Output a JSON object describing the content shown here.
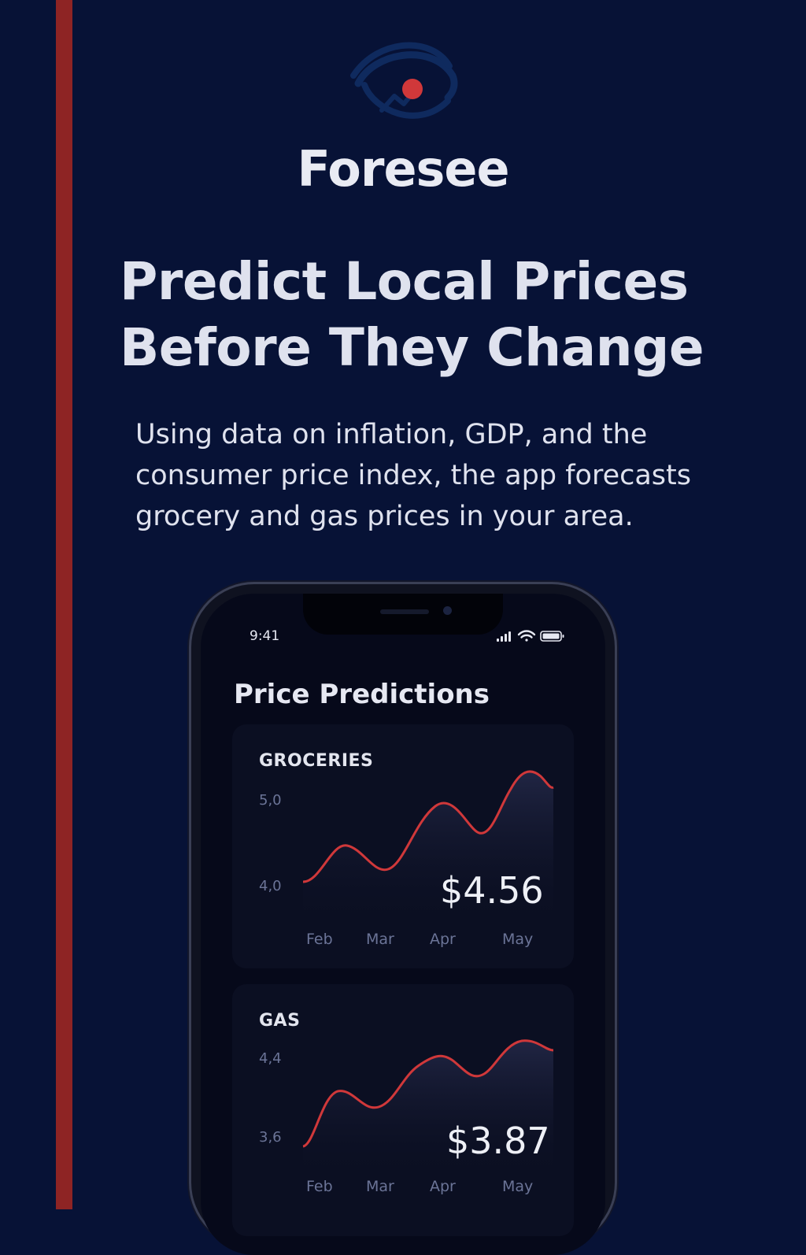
{
  "brand": {
    "name": "Foresee",
    "logo_icon": "eye-chart-icon",
    "accent_color": "#d0383a"
  },
  "headline": [
    "Predict Local Prices",
    "Before They Change"
  ],
  "subtext": [
    "Using data on inflation, GDP, and the",
    "consumer price index, the app forecasts",
    "grocery and gas prices in your area."
  ],
  "phone": {
    "status_time": "9:41",
    "status_icons": [
      "signal-icon",
      "wifi-icon",
      "battery-icon"
    ],
    "title": "Price Predictions",
    "cards": [
      {
        "title": "GROCERIES",
        "ytick_top": "5,0",
        "ytick_bottom": "4,0",
        "price": "$4.56",
        "months": [
          "Feb",
          "Mar",
          "Apr",
          "May"
        ]
      },
      {
        "title": "GAS",
        "ytick_top": "4,4",
        "ytick_bottom": "3,6",
        "price": "$3.87",
        "months": [
          "Feb",
          "Mar",
          "Apr",
          "May"
        ]
      }
    ]
  }
}
